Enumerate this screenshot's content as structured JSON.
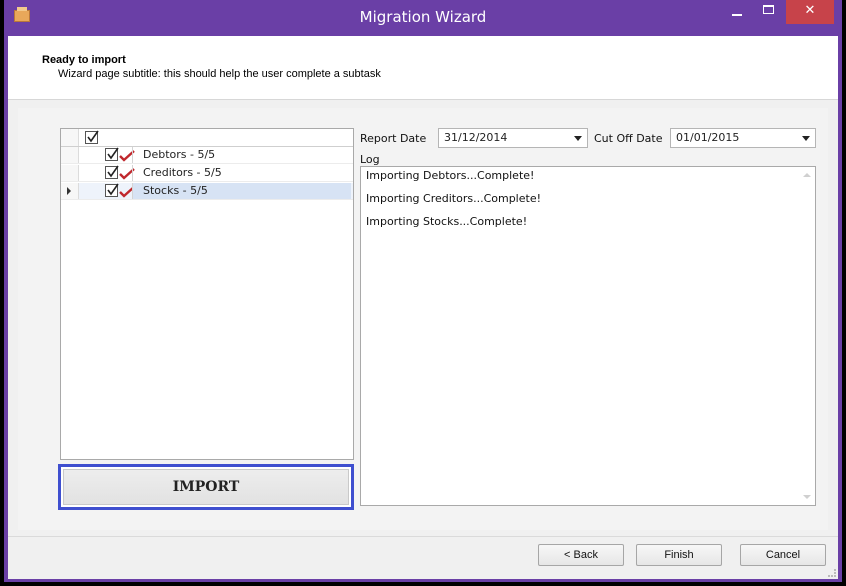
{
  "window": {
    "title": "Migration Wizard"
  },
  "header": {
    "title": "Ready to import",
    "subtitle": "Wizard page subtitle: this should help the user complete a subtask"
  },
  "grid": {
    "rows": [
      {
        "label": "Debtors - 5/5",
        "checked": true,
        "status": "complete"
      },
      {
        "label": "Creditors - 5/5",
        "checked": true,
        "status": "complete"
      },
      {
        "label": "Stocks - 5/5",
        "checked": true,
        "status": "complete",
        "selected": true
      }
    ]
  },
  "import_button": {
    "label": "IMPORT"
  },
  "report_date": {
    "label": "Report Date",
    "value": "31/12/2014"
  },
  "cutoff_date": {
    "label": "Cut Off Date",
    "value": "01/01/2015"
  },
  "log": {
    "label": "Log",
    "lines": [
      "Importing Debtors...Complete!",
      "Importing Creditors...Complete!",
      "Importing Stocks...Complete!"
    ]
  },
  "footer": {
    "back_label": "< Back",
    "finish_label": "Finish",
    "cancel_label": "Cancel"
  },
  "colors": {
    "titlebar": "#6a3fa6",
    "close": "#c7434a",
    "import_highlight": "#3f4fcf",
    "tick": "#c0282d"
  }
}
